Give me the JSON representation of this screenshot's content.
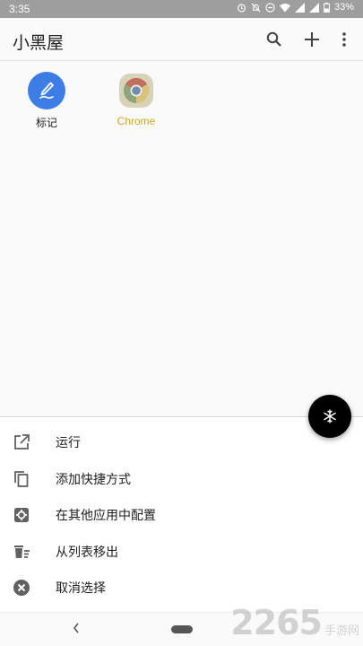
{
  "status_bar": {
    "time": "3:35",
    "battery": "33%"
  },
  "app_bar": {
    "title": "小黑屋",
    "actions": [
      "search-icon",
      "add-icon",
      "more-vert-icon"
    ]
  },
  "apps": [
    {
      "label": "标记",
      "icon": "notes-pen-icon",
      "label_color": "#212121"
    },
    {
      "label": "Chrome",
      "icon": "chrome-icon",
      "label_color": "#c9a81a"
    }
  ],
  "fab": {
    "icon": "snowflake-icon"
  },
  "sheet": {
    "items": [
      {
        "label": "运行",
        "icon": "open-in-new-icon"
      },
      {
        "label": "添加快捷方式",
        "icon": "copy-icon"
      },
      {
        "label": "在其他应用中配置",
        "icon": "settings-icon"
      },
      {
        "label": "从列表移出",
        "icon": "delete-list-icon"
      },
      {
        "label": "取消选择",
        "icon": "cancel-icon"
      }
    ]
  },
  "watermark": {
    "number": "2265",
    "text": "手游网"
  }
}
